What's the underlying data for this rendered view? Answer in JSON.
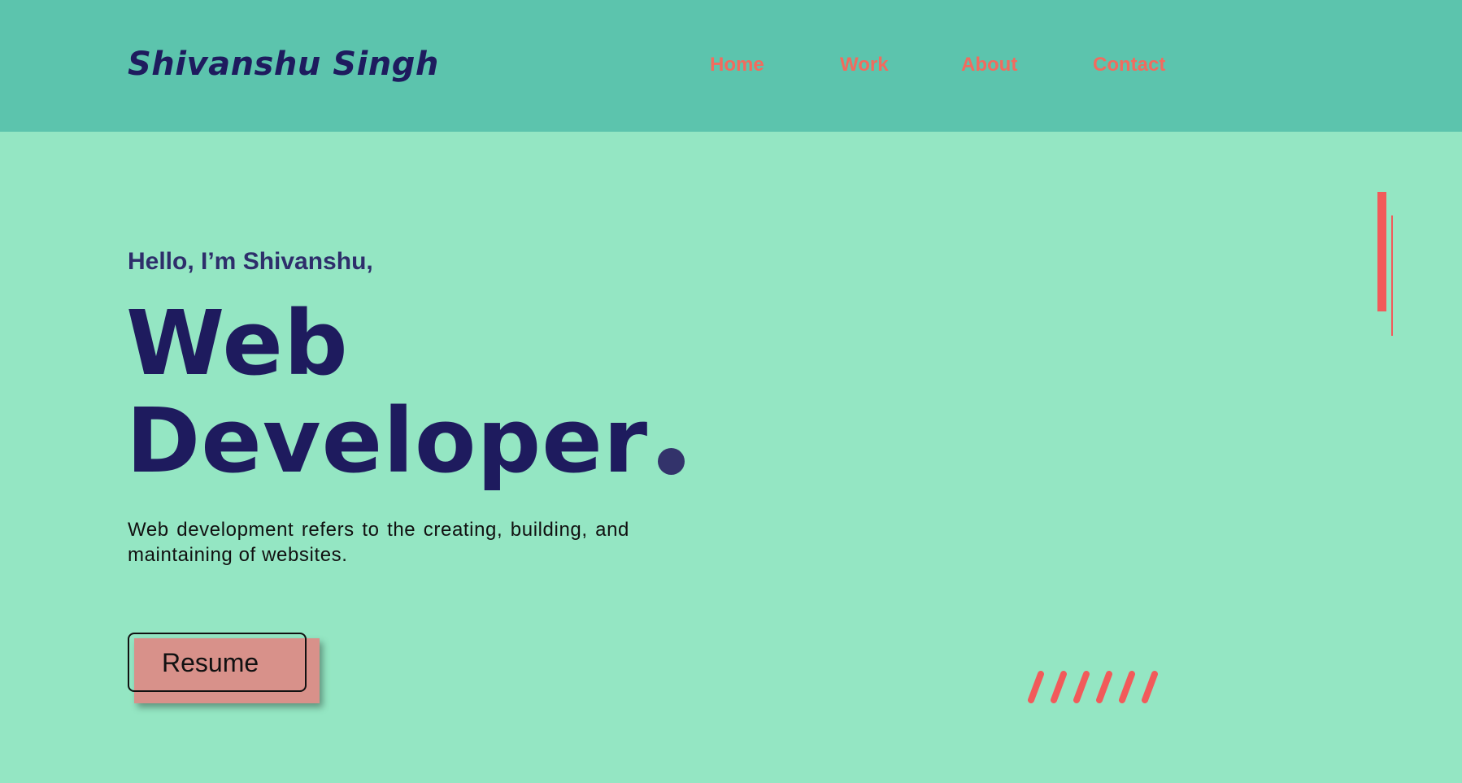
{
  "header": {
    "brand": "Shivanshu Singh",
    "nav": {
      "home": "Home",
      "work": "Work",
      "about": "About",
      "contact": "Contact"
    }
  },
  "hero": {
    "greeting": "Hello, I’m Shivanshu,",
    "headline_line1": "Web",
    "headline_line2": "Developer",
    "description": "Web development refers to the creating, building, and maintaining of websites.",
    "resume_button": "Resume"
  },
  "colors": {
    "header_bg": "#5cc4ad",
    "page_bg": "#94e6c3",
    "brand": "#1e1b5e",
    "nav_link": "#f26b5e",
    "accent": "#f25a5a",
    "resume_fill": "#d8918a"
  },
  "decorations": {
    "headline_dot_icon": "dot-icon",
    "vertical_bars": "vertical-bars-decoration",
    "slashes": "slash-stripes-decoration"
  }
}
